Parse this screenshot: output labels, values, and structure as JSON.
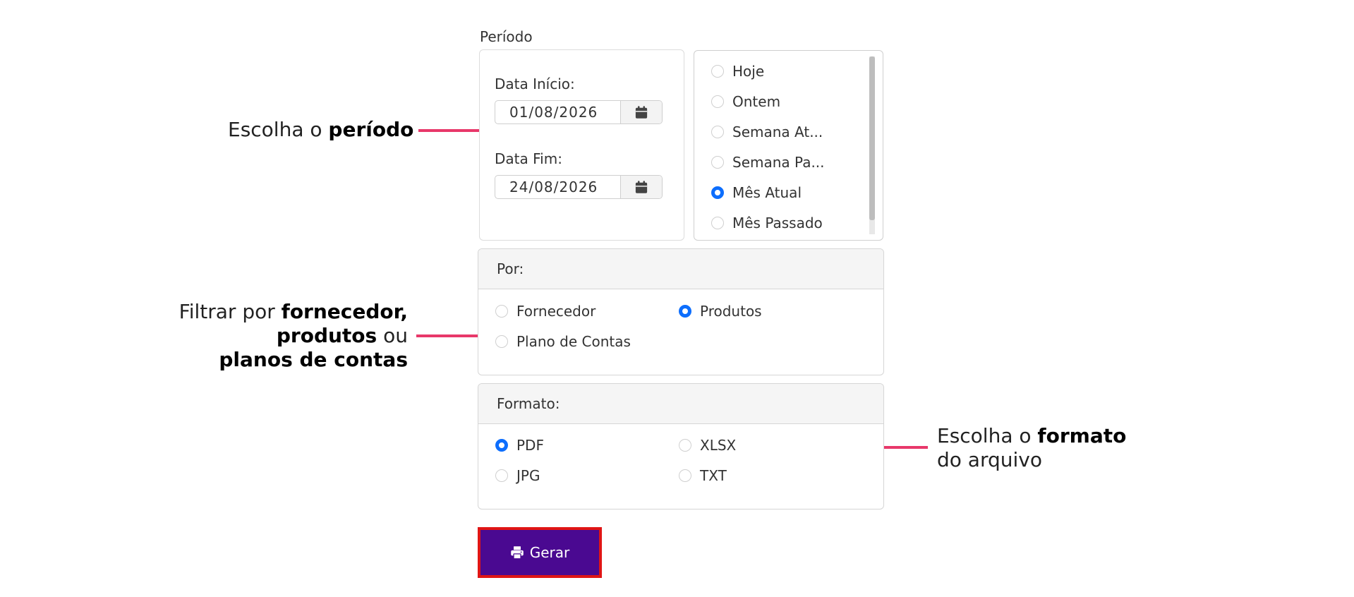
{
  "period": {
    "title": "Período",
    "start_label": "Data Início:",
    "start_value": "01/08/2026",
    "end_label": "Data Fim:",
    "end_value": "24/08/2026",
    "quick_options": [
      {
        "label": "Hoje",
        "checked": false
      },
      {
        "label": "Ontem",
        "checked": false
      },
      {
        "label": "Semana At...",
        "checked": false
      },
      {
        "label": "Semana Pa...",
        "checked": false
      },
      {
        "label": "Mês Atual",
        "checked": true
      },
      {
        "label": "Mês Passado",
        "checked": false
      }
    ]
  },
  "filter": {
    "header": "Por:",
    "options": [
      {
        "label": "Fornecedor",
        "checked": false
      },
      {
        "label": "Produtos",
        "checked": true
      },
      {
        "label": "Plano de Contas",
        "checked": false
      }
    ]
  },
  "format": {
    "header": "Formato:",
    "options": [
      {
        "label": "PDF",
        "checked": true
      },
      {
        "label": "XLSX",
        "checked": false
      },
      {
        "label": "JPG",
        "checked": false
      },
      {
        "label": "TXT",
        "checked": false
      }
    ]
  },
  "generate_button": {
    "label": "Gerar",
    "icon": "printer-icon"
  },
  "annotations": {
    "period": {
      "text": "Escolha o ",
      "bold": "período"
    },
    "filter": {
      "line1_text": "Filtrar por ",
      "line1_bold": "fornecedor,",
      "line2_bold": "produtos",
      "line2_text": " ou",
      "line3_bold": "planos de contas"
    },
    "format": {
      "line1_text": "Escolha o ",
      "line1_bold": "formato",
      "line2_text": "do arquivo"
    }
  },
  "colors": {
    "accent": "#0d6efd",
    "button": "#4a0991",
    "annotation_line": "#e8386a",
    "highlight_border": "#e01515"
  }
}
